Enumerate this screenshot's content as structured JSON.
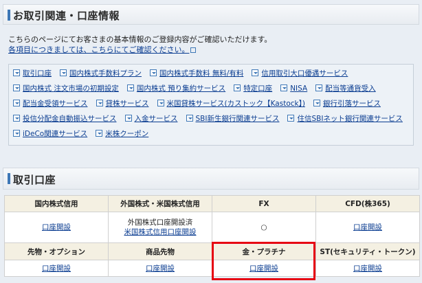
{
  "section1": {
    "title": "お取引関連・口座情報",
    "intro": "こちらのページにてお客さまの基本情報のご登録内容がご確認いただけます。",
    "intro_link": "各項目につきましては、こちらにてご確認ください。"
  },
  "links": [
    [
      "取引口座",
      "国内株式手数料プラン",
      "国内株式手数料 無料/有料",
      "信用取引大口優遇サービス"
    ],
    [
      "国内株式 注文市場の初期設定",
      "国内株式 預り集約サービス",
      "特定口座",
      "NISA",
      "配当等通貨受入"
    ],
    [
      "配当金受領サービス",
      "貸株サービス",
      "米国貸株サービス(カストック【Kastock】)",
      "銀行引落サービス"
    ],
    [
      "投信分配金自動振込サービス",
      "入金サービス",
      "SBI新生銀行関連サービス",
      "住信SBIネット銀行関連サービス"
    ],
    [
      "iDeCo関連サービス",
      "米株クーポン"
    ]
  ],
  "section2": {
    "title": "取引口座"
  },
  "table": {
    "row1_headers": [
      "国内株式信用",
      "外国株式・米国株式信用",
      "FX",
      "CFD(株365)"
    ],
    "row1_cells": {
      "c1": "口座開設",
      "c2_text": "外国株式口座開設済",
      "c2_link": "米国株式信用口座開設",
      "c3": "○",
      "c4": "口座開設"
    },
    "row2_headers": [
      "先物・オプション",
      "商品先物",
      "金・プラチナ",
      "ST(セキュリティ・トークン)"
    ],
    "row2_cells": [
      "口座開設",
      "口座開設",
      "口座開設",
      "口座開設"
    ]
  },
  "colors": {
    "accent": "#3d77b6",
    "highlight": "#e60012",
    "link": "#0b3d91"
  }
}
